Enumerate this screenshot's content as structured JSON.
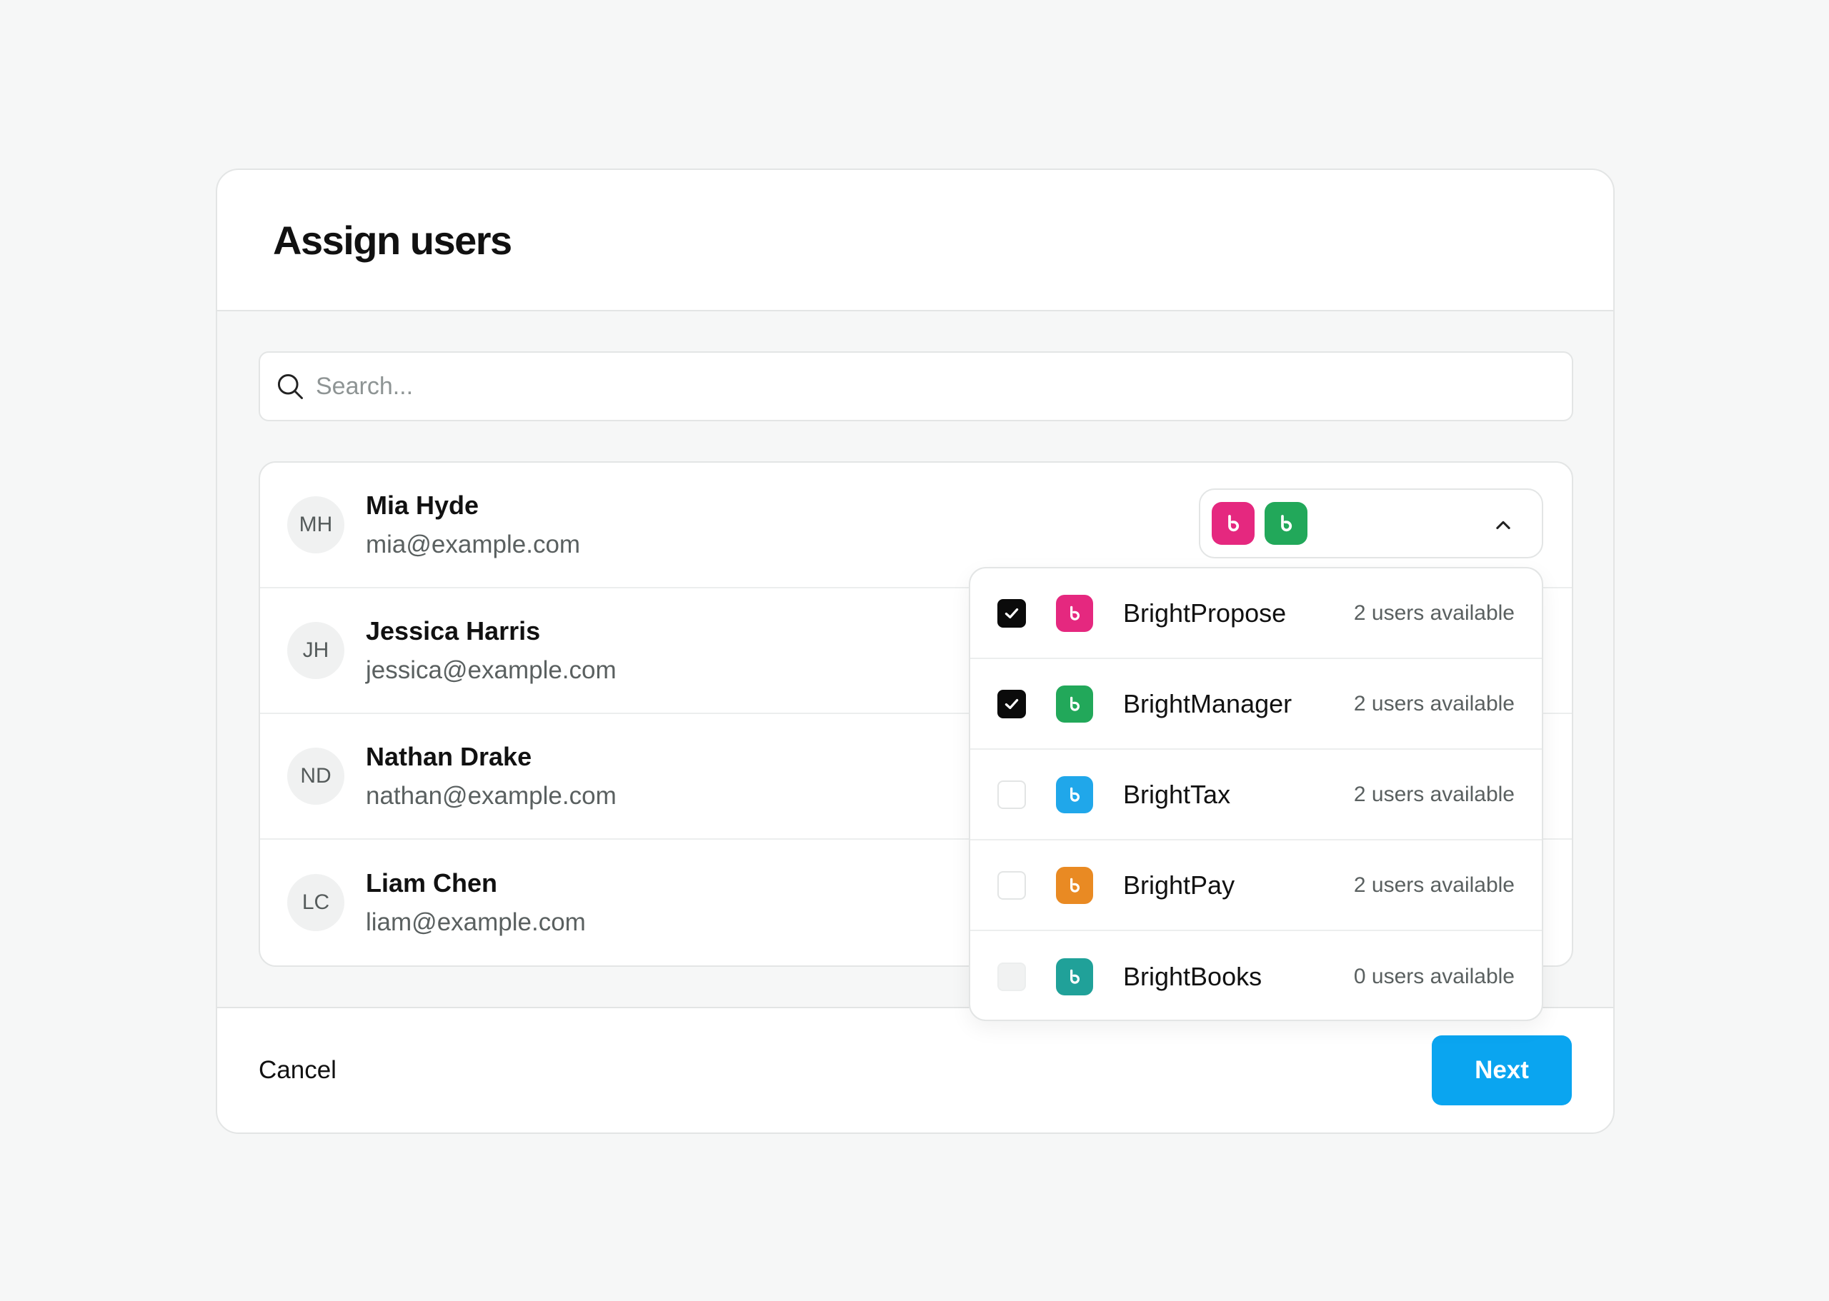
{
  "modal": {
    "title": "Assign users"
  },
  "search": {
    "placeholder": "Search...",
    "value": ""
  },
  "users": [
    {
      "initials": "MH",
      "name": "Mia Hyde",
      "email": "mia@example.com"
    },
    {
      "initials": "JH",
      "name": "Jessica Harris",
      "email": "jessica@example.com"
    },
    {
      "initials": "ND",
      "name": "Nathan Drake",
      "email": "nathan@example.com"
    },
    {
      "initials": "LC",
      "name": "Liam Chen",
      "email": "liam@example.com"
    }
  ],
  "product_select": {
    "selected_colors": [
      "#e5287f",
      "#22a85a"
    ],
    "icon": "chevron-up-icon"
  },
  "products": [
    {
      "name": "BrightPropose",
      "availability": "2 users available",
      "color": "#e5287f",
      "checked": true,
      "disabled": false
    },
    {
      "name": "BrightManager",
      "availability": "2 users available",
      "color": "#22a85a",
      "checked": true,
      "disabled": false
    },
    {
      "name": "BrightTax",
      "availability": "2 users available",
      "color": "#20a7ea",
      "checked": false,
      "disabled": false
    },
    {
      "name": "BrightPay",
      "availability": "2 users available",
      "color": "#e98a23",
      "checked": false,
      "disabled": false
    },
    {
      "name": "BrightBooks",
      "availability": "0 users available",
      "color": "#20a199",
      "checked": false,
      "disabled": true
    }
  ],
  "footer": {
    "cancel_label": "Cancel",
    "next_label": "Next"
  }
}
